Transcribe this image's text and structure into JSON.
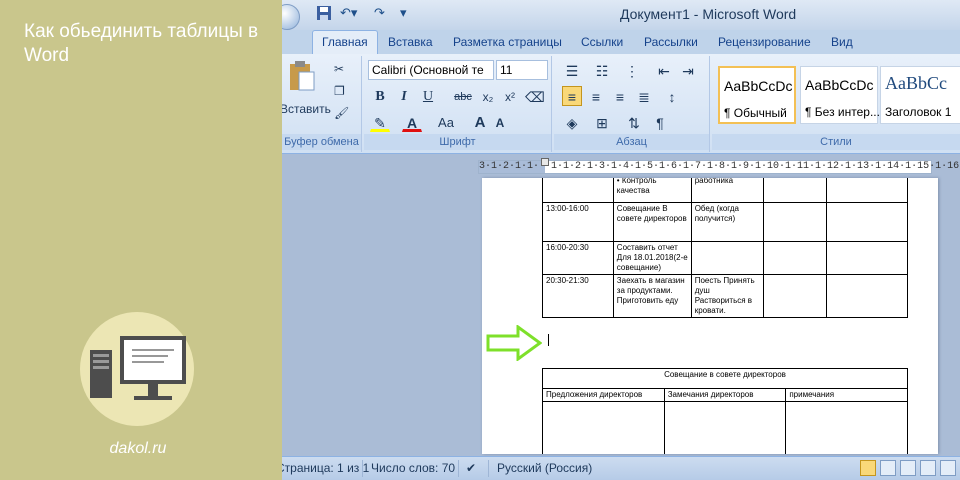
{
  "promo": {
    "title": "Как обьединить таблицы в Word",
    "site": "dakol.ru"
  },
  "window": {
    "title": "Документ1 - Microsoft Word"
  },
  "tabs": [
    "Главная",
    "Вставка",
    "Разметка страницы",
    "Ссылки",
    "Рассылки",
    "Рецензирование",
    "Вид"
  ],
  "ribbon": {
    "paste_label": "Вставить",
    "clipboard_label": "Буфер обмена",
    "font_name": "Calibri (Основной те",
    "font_size": "11",
    "font_group_label": "Шрифт",
    "bold": "B",
    "italic": "I",
    "underline": "U",
    "strike": "abc",
    "subscript": "x₂",
    "superscript": "x²",
    "change_case": "Aa",
    "grow_font": "A",
    "shrink_font": "A",
    "paragraph_label": "Абзац",
    "styles_label": "Стили",
    "styles": [
      {
        "sample": "AaBbCcDc",
        "name": "¶ Обычный"
      },
      {
        "sample": "AaBbCcDc",
        "name": "¶ Без интер..."
      },
      {
        "sample": "AaBbCc",
        "name": "Заголовок 1"
      }
    ]
  },
  "ruler": {
    "text": "3·1·2·1·1· ·1·1·2·1·3·1·4·1·5·1·6·1·7·1·8·1·9·1·10·1·11·1·12·1·13·1·14·1·15·1·16·1·17"
  },
  "table1": {
    "rows": [
      [
        "",
        "• Контроль качества",
        "работника",
        "",
        ""
      ],
      [
        "13:00-16:00",
        "Совещание В совете директоров",
        "Обед (когда получится)",
        "",
        ""
      ],
      [
        "16:00-20:30",
        "Составить отчет Для 18.01.2018(2-е совещание)",
        "",
        "",
        ""
      ],
      [
        "20:30-21:30",
        "Заехать в магазин за продуктами. Приготовить еду",
        "Поесть Принять душ Раствориться в кровати.",
        "",
        ""
      ]
    ]
  },
  "table2": {
    "header": "Совещание в совете директоров",
    "columns": [
      "Предложения директоров",
      "Замечания директоров",
      "примечания"
    ]
  },
  "status": {
    "page": "Страница: 1 из 1",
    "words": "Число слов: 70",
    "language": "Русский (Россия)"
  }
}
